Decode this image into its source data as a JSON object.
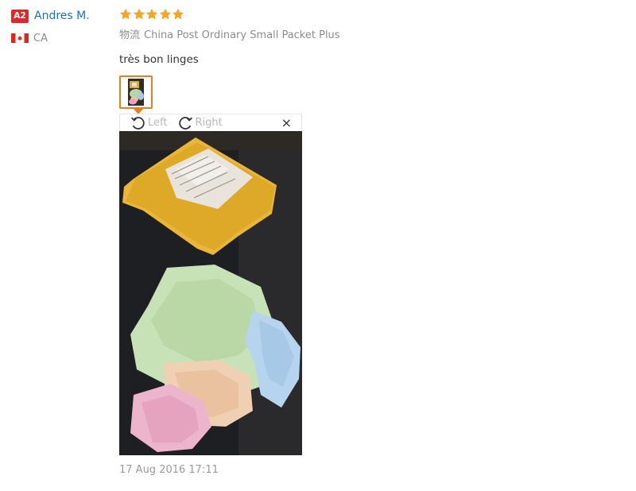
{
  "user": {
    "level_badge": "A2",
    "name": "Andres M.",
    "country_code": "CA",
    "flag": "canada-flag-icon"
  },
  "review": {
    "rating": 5,
    "star_color": "#f5a623",
    "shipping_label": "物流",
    "shipping_method": "China Post Ordinary Small Packet Plus",
    "text": "très bon linges",
    "timestamp": "17 Aug 2016 17:11"
  },
  "viewer": {
    "rotate_left_label": "Left",
    "rotate_right_label": "Right",
    "close_symbol": "×"
  },
  "colors": {
    "badge": "#e0282a",
    "name_link": "#1e6fbf",
    "thumb_border": "#e67e22"
  }
}
